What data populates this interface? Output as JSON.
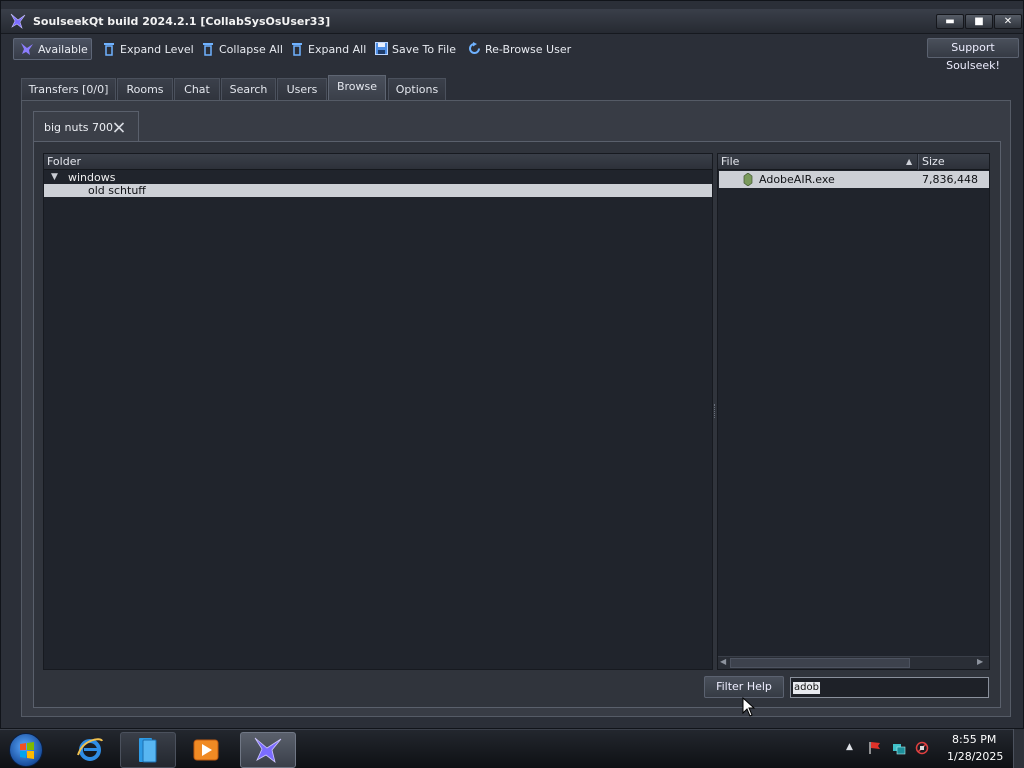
{
  "window": {
    "title": "SoulseekQt build 2024.2.1 [CollabSysOsUser33]",
    "controls": {
      "minimize": "▬",
      "maximize": "■",
      "close": "✕"
    }
  },
  "toolbar": {
    "status": "Available",
    "expand_level": "Expand Level",
    "collapse_all": "Collapse All",
    "expand_all": "Expand All",
    "save_to_file": "Save To File",
    "re_browse_user": "Re-Browse User",
    "support": "Support Soulseek!"
  },
  "tabs": [
    {
      "label": "Transfers [0/0]"
    },
    {
      "label": "Rooms"
    },
    {
      "label": "Chat"
    },
    {
      "label": "Search"
    },
    {
      "label": "Users"
    },
    {
      "label": "Browse",
      "active": true
    },
    {
      "label": "Options"
    }
  ],
  "browse": {
    "user_tab": "big nuts 700",
    "folder_header": "Folder",
    "folders": [
      {
        "name": "windows",
        "expanded": true
      },
      {
        "name": "old schtuff",
        "selected": true
      }
    ],
    "file_header": "File",
    "size_header": "Size",
    "sort_indicator": "▲",
    "files": [
      {
        "name": "AdobeAIR.exe",
        "size": "7,836,448"
      }
    ],
    "filter_help": "Filter Help",
    "filter_value": "adob"
  },
  "taskbar": {
    "time": "8:55 PM",
    "date": "1/28/2025"
  },
  "colors": {
    "window_bg": "#2b2f38",
    "pane_bg": "#20242c",
    "selection": "#cdd0d6",
    "accent": "#6a5cff"
  }
}
